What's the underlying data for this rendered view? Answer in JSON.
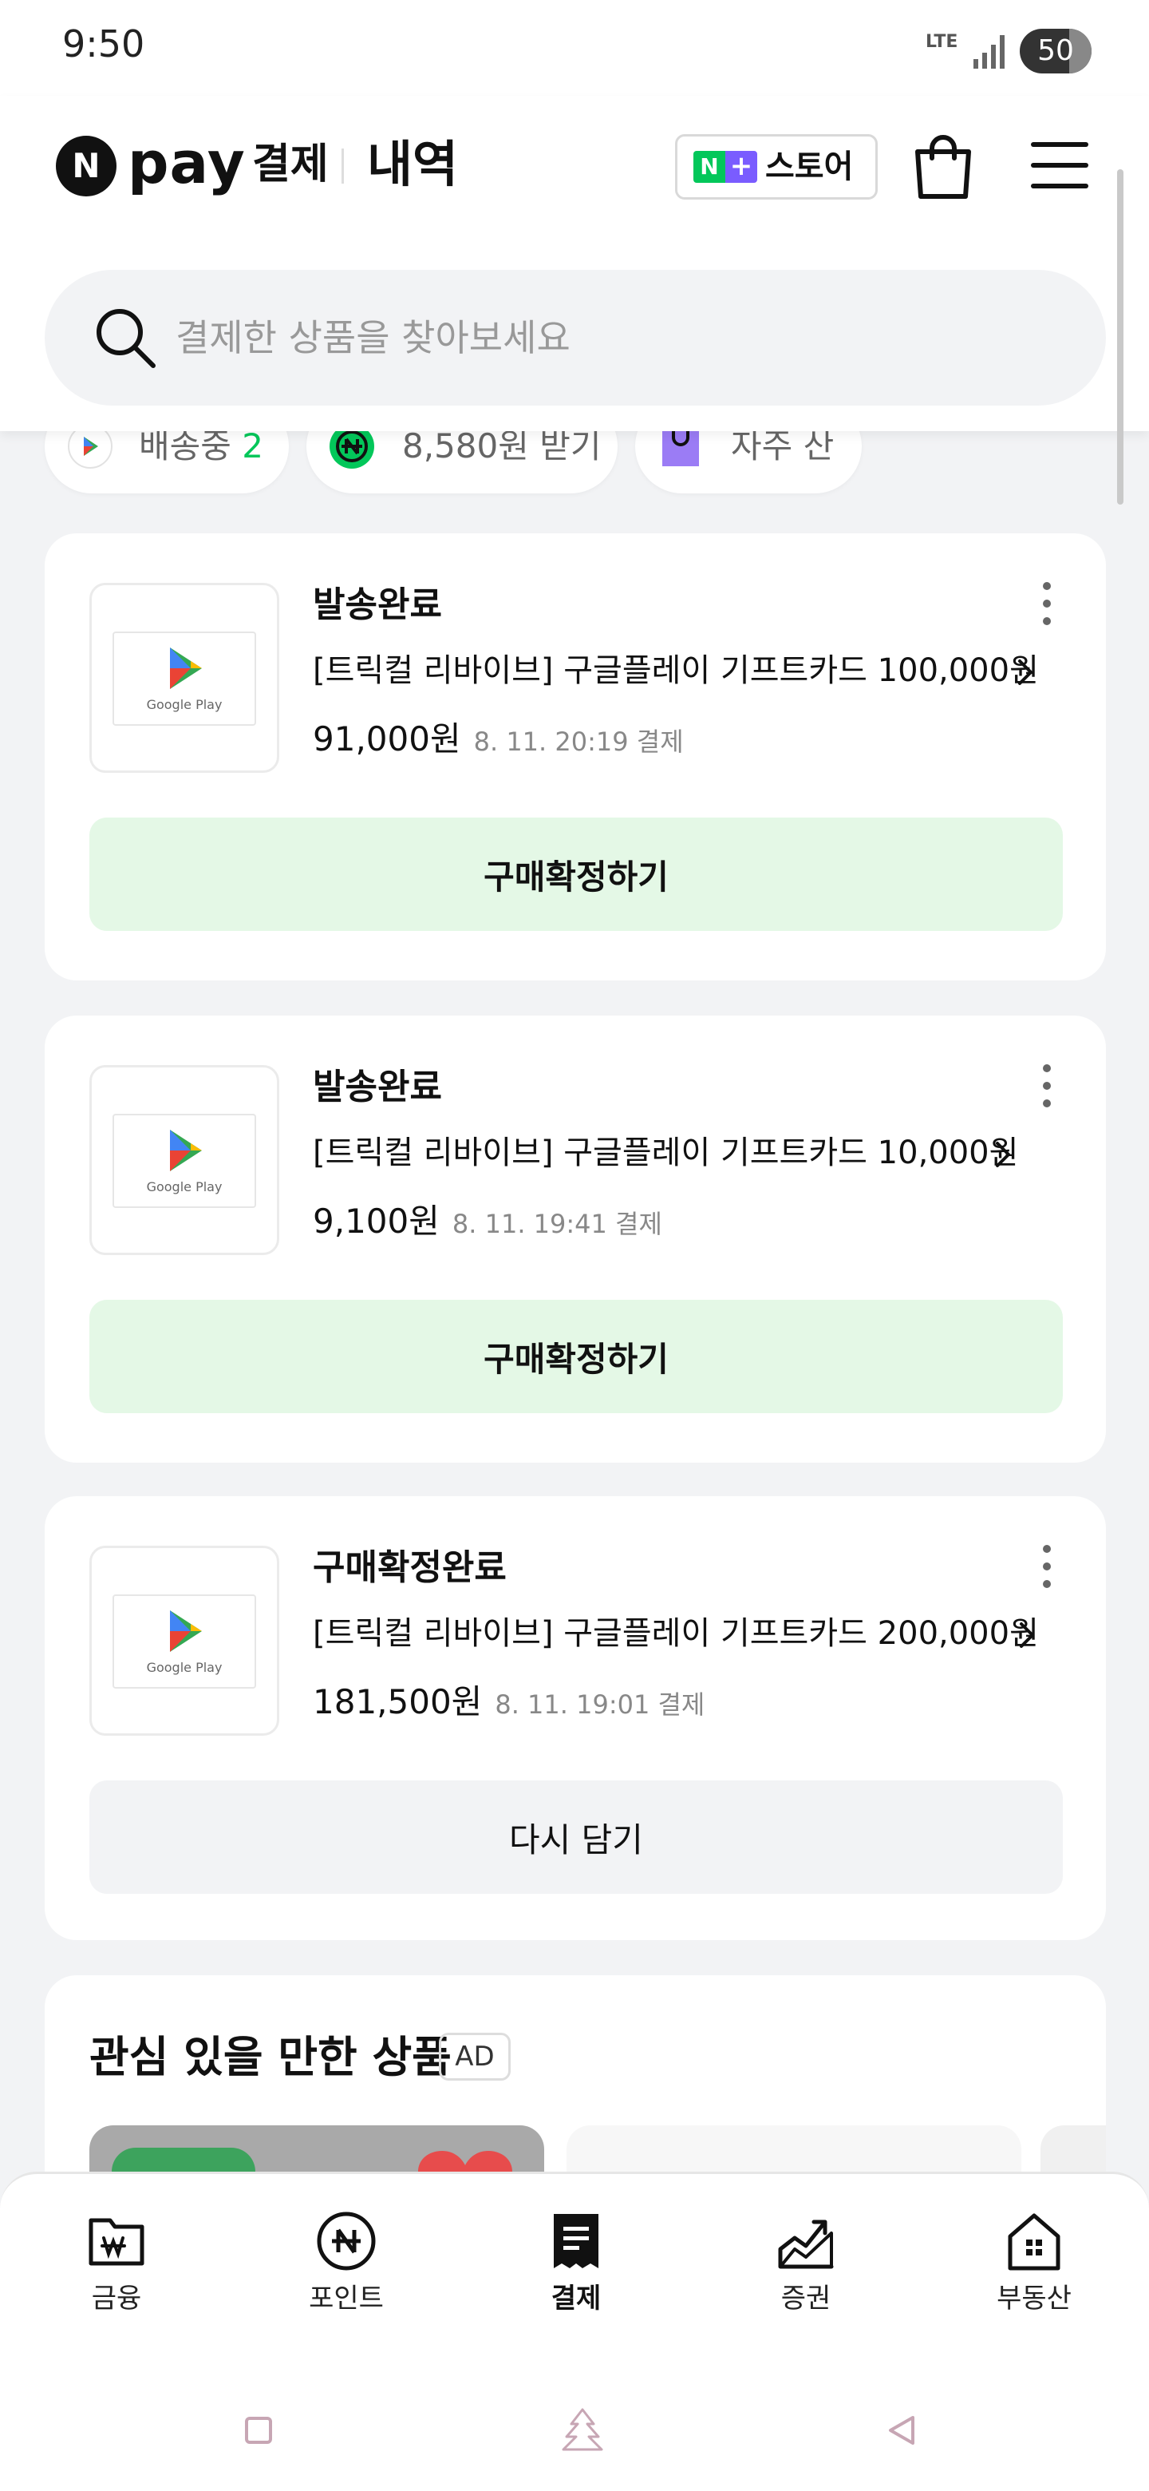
{
  "status_bar": {
    "time": "9:50",
    "network": "LTE",
    "battery": "50"
  },
  "header": {
    "logo_n": "N",
    "brand": "pay",
    "brand_sub": "결제",
    "section": "내역",
    "store_button": {
      "n": "N",
      "plus": "+",
      "label": "스토어"
    }
  },
  "search": {
    "placeholder": "결제한 상품을 찾아보세요",
    "value": ""
  },
  "chips": [
    {
      "label": "배송중",
      "count": "2"
    },
    {
      "label": "8,580원 받기"
    },
    {
      "label": "자주 산"
    }
  ],
  "orders": [
    {
      "status": "발송완료",
      "title": "[트릭컬 리바이브] 구글플레이 기프트카드 100,000원",
      "price": "91,000원",
      "date": "8. 11. 20:19 결제",
      "action": "구매확정하기",
      "thumb_label": "Google Play"
    },
    {
      "status": "발송완료",
      "title": "[트릭컬 리바이브] 구글플레이 기프트카드 10,000원",
      "price": "9,100원",
      "date": "8. 11. 19:41 결제",
      "action": "구매확정하기",
      "thumb_label": "Google Play"
    },
    {
      "status": "구매확정완료",
      "title": "[트릭컬 리바이브] 구글플레이 기프트카드 200,000원",
      "price": "181,500원",
      "date": "8. 11. 19:01 결제",
      "action": "다시 담기",
      "thumb_label": "Google Play"
    }
  ],
  "recommendations": {
    "title": "관심 있을 만한 상품",
    "ad_badge": "AD"
  },
  "bottom_nav": [
    {
      "label": "금융",
      "icon": "wallet-won-icon"
    },
    {
      "label": "포인트",
      "icon": "point-coin-icon"
    },
    {
      "label": "결제",
      "icon": "receipt-icon",
      "active": true
    },
    {
      "label": "증권",
      "icon": "stock-chart-icon"
    },
    {
      "label": "부동산",
      "icon": "house-icon"
    }
  ],
  "colors": {
    "accent_green": "#03c75a",
    "confirm_bg": "#e4f8e6",
    "store_purple": "#7a5cff"
  }
}
